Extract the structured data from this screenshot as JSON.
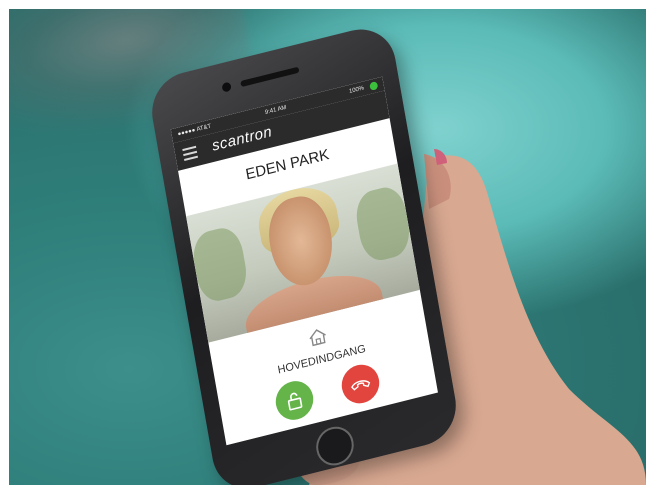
{
  "photo": {
    "alt": ""
  },
  "phone": {
    "status": {
      "carrier": "●●●●● AT&T",
      "time": "9:41 AM",
      "battery": "100%"
    },
    "app": {
      "brand": "scantron",
      "location_title": "EDEN PARK",
      "entrance_label": "HOVEDINDGANG"
    },
    "buttons": {
      "unlock_icon": "unlock-icon",
      "hangup_icon": "phone-hangup-icon"
    },
    "colors": {
      "unlock": "#64b44a",
      "hangup": "#e2453d",
      "navbar": "#2b2b2b",
      "status_dot": "#3cbf3c"
    }
  }
}
